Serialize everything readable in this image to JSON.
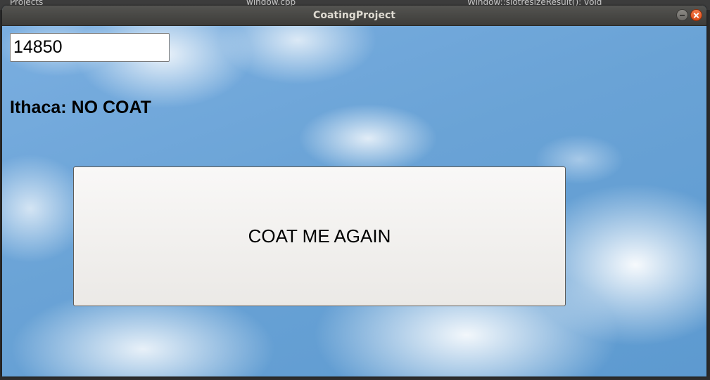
{
  "window": {
    "title": "CoatingProject"
  },
  "background_app": {
    "left_text": "Projects",
    "file_text": "window.cpp",
    "symbol_text": "Window::slotresizeResult(): void"
  },
  "form": {
    "zip_value": "14850",
    "result_text": "Ithaca: NO COAT",
    "button_label": "COAT ME AGAIN"
  },
  "colors": {
    "sky": "#6aa3d4",
    "titlebar": "#3d3c39",
    "close_button": "#de4c17"
  },
  "icons": [
    "minimize-icon",
    "close-icon"
  ]
}
